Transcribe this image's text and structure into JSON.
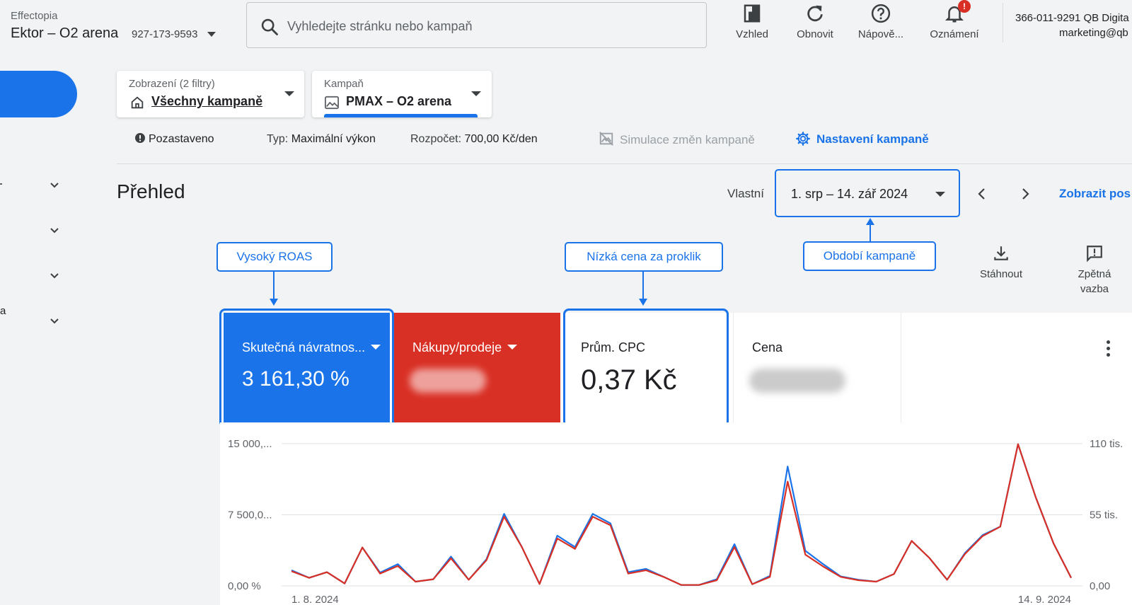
{
  "header": {
    "org": "Effectopia",
    "account_name": "Ektor – O2 arena",
    "account_id": "927-173-9593",
    "search_placeholder": "Vyhledejte stránku nebo kampaň",
    "tools": {
      "appearance": "Vzhled",
      "refresh": "Obnovit",
      "help": "Nápově...",
      "notifications": "Oznámení",
      "notification_badge": "!"
    },
    "account_right_line1": "366-011-9291 QB Digita",
    "account_right_line2": "marketing@qb"
  },
  "sidebar": {
    "edge_text": "a"
  },
  "filters": {
    "view_label": "Zobrazení (2 filtry)",
    "view_value": "Všechny kampaně",
    "campaign_label": "Kampaň",
    "campaign_value": "PMAX – O2 arena"
  },
  "status": {
    "state": "Pozastaveno",
    "type_key": "Typ:",
    "type_value": "Maximální výkon",
    "budget_key": "Rozpočet:",
    "budget_value": "700,00 Kč/den",
    "simulation": "Simulace změn kampaně",
    "settings": "Nastavení kampaně"
  },
  "overview": {
    "title": "Přehled",
    "range_type": "Vlastní",
    "date_range": "1. srp – 14. zář 2024",
    "show_link": "Zobrazit pos"
  },
  "callouts": {
    "roas": "Vysoký ROAS",
    "cpc": "Nízká cena za proklik",
    "period": "Období kampaně"
  },
  "right_tools": {
    "download": "Stáhnout",
    "feedback_line1": "Zpětná",
    "feedback_line2": "vazba"
  },
  "scorecards": [
    {
      "title": "Skutečná návratnos...",
      "value": "3 161,30 %",
      "bg": "#1a73e8",
      "fg": "#ffffff"
    },
    {
      "title": "Nákupy/prodeje",
      "value": "",
      "bg": "#d93025",
      "fg": "#ffffff"
    },
    {
      "title": "Prům. CPC",
      "value": "0,37 Kč",
      "bg": "#ffffff",
      "fg": "#202124"
    },
    {
      "title": "Cena",
      "value": "",
      "bg": "#ffffff",
      "fg": "#202124"
    }
  ],
  "colors": {
    "accent": "#1a73e8",
    "red": "#d93025"
  },
  "chart_data": {
    "type": "line",
    "x_start_label": "1. 8. 2024",
    "x_end_label": "14. 9. 2024",
    "left_axis_ticks": [
      "15 000,...",
      "7 500,0...",
      "0,00 %"
    ],
    "right_axis_ticks": [
      "110 tis.",
      "55 tis.",
      "0,00"
    ],
    "left_ylim": [
      0,
      15000
    ],
    "right_ylim": [
      0,
      110000
    ],
    "gridlines": true,
    "series": [
      {
        "color": "#1a73e8",
        "axis": "left",
        "values": [
          1650,
          850,
          1450,
          250,
          4050,
          1400,
          2300,
          450,
          700,
          3100,
          650,
          2800,
          7600,
          4100,
          200,
          5300,
          4100,
          7600,
          6600,
          1450,
          1800,
          950,
          100,
          100,
          700,
          4400,
          180,
          1050,
          12600,
          3700,
          2300,
          1000,
          650,
          450,
          1250,
          4750,
          2950,
          650,
          3450,
          5350,
          6250,
          14950,
          9350,
          4500,
          850
        ]
      },
      {
        "color": "#d93025",
        "axis": "left",
        "values": [
          1550,
          850,
          1450,
          250,
          4050,
          1300,
          2100,
          450,
          700,
          2900,
          650,
          2700,
          7300,
          4100,
          200,
          5000,
          3900,
          7300,
          6400,
          1300,
          1650,
          950,
          100,
          100,
          600,
          4100,
          180,
          950,
          11000,
          3300,
          2050,
          950,
          600,
          450,
          1250,
          4750,
          2950,
          650,
          3350,
          5250,
          6250,
          14950,
          9350,
          4500,
          850
        ]
      }
    ]
  }
}
